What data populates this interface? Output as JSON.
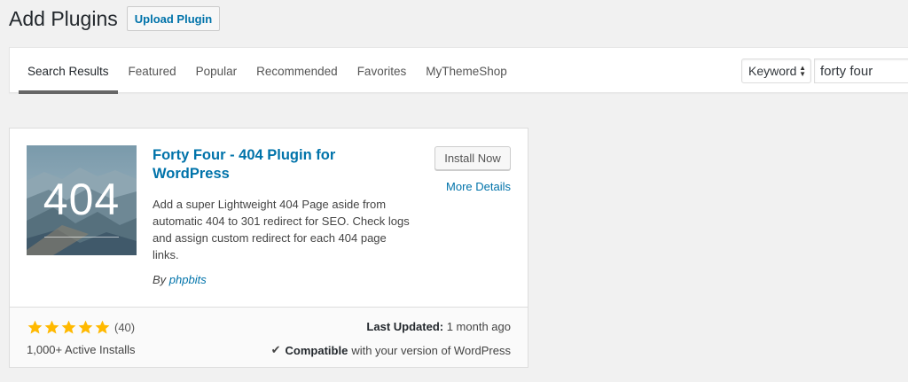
{
  "header": {
    "title": "Add Plugins",
    "upload_label": "Upload Plugin"
  },
  "tabs": [
    {
      "label": "Search Results",
      "current": true
    },
    {
      "label": "Featured"
    },
    {
      "label": "Popular"
    },
    {
      "label": "Recommended"
    },
    {
      "label": "Favorites"
    },
    {
      "label": "MyThemeShop"
    }
  ],
  "search": {
    "type_selected": "Keyword",
    "query": "forty four"
  },
  "plugin": {
    "thumbnail_text": "404",
    "name": "Forty Four - 404 Plugin for WordPress",
    "description": "Add a super Lightweight 404 Page aside from automatic 404 to 301 redirect for SEO. Check logs and assign custom redirect for each 404 page links.",
    "author_prefix": "By",
    "author": "phpbits",
    "install_label": "Install Now",
    "details_label": "More Details",
    "rating_stars": 5,
    "rating_count": "(40)",
    "active_installs": "1,000+ Active Installs",
    "last_updated_label": "Last Updated:",
    "last_updated_value": "1 month ago",
    "compatible_bold": "Compatible",
    "compatible_rest": "with your version of WordPress"
  },
  "colors": {
    "link": "#0073aa",
    "star": "#ffb900"
  }
}
